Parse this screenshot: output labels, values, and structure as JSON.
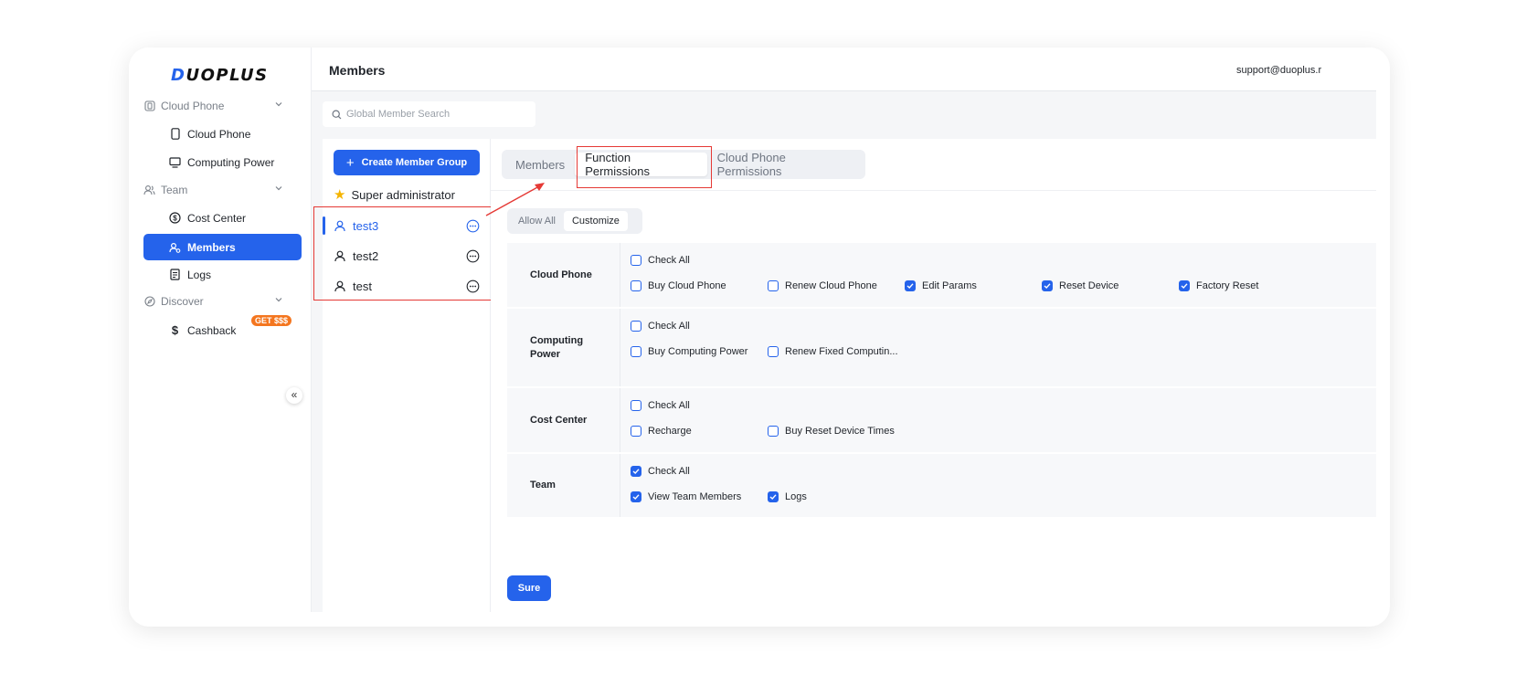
{
  "app": {
    "logo": "DUOPLUS",
    "logo_accent": "D"
  },
  "sidebar": {
    "groups": [
      {
        "label": "Cloud Phone",
        "items": [
          "Cloud Phone",
          "Computing Power"
        ]
      },
      {
        "label": "Team",
        "items": [
          "Cost Center",
          "Members",
          "Logs"
        ]
      },
      {
        "label": "Discover",
        "items": [
          "Cashback"
        ]
      }
    ],
    "cloud_phone_group": "Cloud Phone",
    "cloud_phone": "Cloud Phone",
    "computing_power": "Computing Power",
    "team_group": "Team",
    "cost_center": "Cost Center",
    "members": "Members",
    "logs": "Logs",
    "discover_group": "Discover",
    "cashback": "Cashback",
    "cashback_badge": "GET $$$",
    "collapse_glyph": "«"
  },
  "header": {
    "title": "Members",
    "email": "support@duoplus.r"
  },
  "search": {
    "placeholder": "Global Member Search"
  },
  "groups_panel": {
    "create_label": "Create Member Group",
    "super_admin": "Super administrator",
    "groups": [
      {
        "name": "test3",
        "active": true
      },
      {
        "name": "test2",
        "active": false
      },
      {
        "name": "test",
        "active": false
      }
    ]
  },
  "tabs": {
    "members": "Members",
    "function_permissions": "Function Permissions",
    "cloud_phone_permissions": "Cloud Phone Permissions",
    "active": "Function Permissions"
  },
  "mode": {
    "allow_all": "Allow All",
    "customize": "Customize",
    "selected": "Customize"
  },
  "permissions": {
    "cloud_phone": {
      "title": "Cloud Phone",
      "check_all": {
        "label": "Check All",
        "checked": false
      },
      "items": [
        {
          "label": "Buy Cloud Phone",
          "checked": false
        },
        {
          "label": "Renew Cloud Phone",
          "checked": false
        },
        {
          "label": "Edit Params",
          "checked": true
        },
        {
          "label": "Reset Device",
          "checked": true
        },
        {
          "label": "Factory Reset",
          "checked": true
        }
      ]
    },
    "computing_power": {
      "title": "Computing Power",
      "check_all": {
        "label": "Check All",
        "checked": false
      },
      "items": [
        {
          "label": "Buy Computing Power",
          "checked": false
        },
        {
          "label": "Renew Fixed Computin...",
          "checked": false
        }
      ]
    },
    "cost_center": {
      "title": "Cost Center",
      "check_all": {
        "label": "Check All",
        "checked": false
      },
      "items": [
        {
          "label": "Recharge",
          "checked": false
        },
        {
          "label": "Buy Reset Device Times",
          "checked": false
        }
      ]
    },
    "team": {
      "title": "Team",
      "check_all": {
        "label": "Check All",
        "checked": true
      },
      "items": [
        {
          "label": "View Team Members",
          "checked": true
        },
        {
          "label": "Logs",
          "checked": true
        }
      ]
    }
  },
  "actions": {
    "sure": "Sure"
  },
  "colors": {
    "accent": "#2563eb",
    "highlight": "#e53935",
    "badge": "#f4761f",
    "star": "#f5b400"
  }
}
